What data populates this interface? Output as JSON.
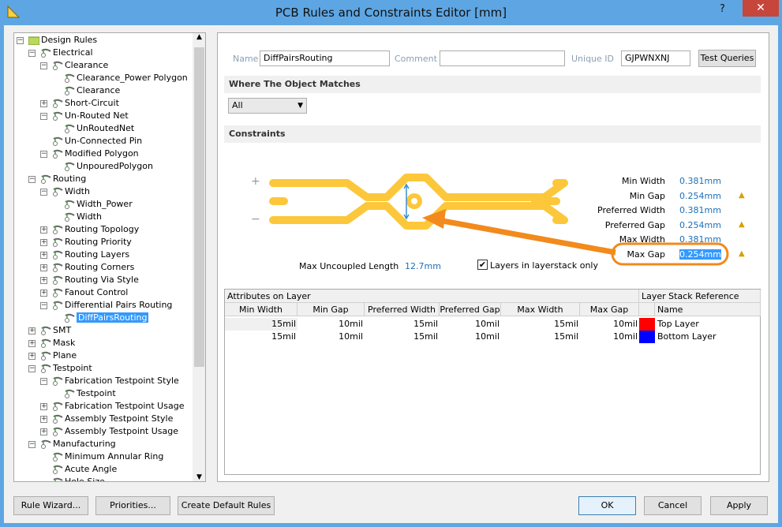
{
  "window": {
    "title": "PCB Rules and Constraints Editor [mm]",
    "help": "?",
    "close": "✕"
  },
  "tree": [
    {
      "label": "Design Rules",
      "level": 0,
      "exp": "-"
    },
    {
      "label": "Electrical",
      "level": 1,
      "exp": "-"
    },
    {
      "label": "Clearance",
      "level": 2,
      "exp": "-"
    },
    {
      "label": "Clearance_Power Polygon",
      "level": 3
    },
    {
      "label": "Clearance",
      "level": 3
    },
    {
      "label": "Short-Circuit",
      "level": 2,
      "exp": "+"
    },
    {
      "label": "Un-Routed Net",
      "level": 2,
      "exp": "-"
    },
    {
      "label": "UnRoutedNet",
      "level": 3
    },
    {
      "label": "Un-Connected Pin",
      "level": 2
    },
    {
      "label": "Modified Polygon",
      "level": 2,
      "exp": "-"
    },
    {
      "label": "UnpouredPolygon",
      "level": 3
    },
    {
      "label": "Routing",
      "level": 1,
      "exp": "-"
    },
    {
      "label": "Width",
      "level": 2,
      "exp": "-"
    },
    {
      "label": "Width_Power",
      "level": 3
    },
    {
      "label": "Width",
      "level": 3
    },
    {
      "label": "Routing Topology",
      "level": 2,
      "exp": "+"
    },
    {
      "label": "Routing Priority",
      "level": 2,
      "exp": "+"
    },
    {
      "label": "Routing Layers",
      "level": 2,
      "exp": "+"
    },
    {
      "label": "Routing Corners",
      "level": 2,
      "exp": "+"
    },
    {
      "label": "Routing Via Style",
      "level": 2,
      "exp": "+"
    },
    {
      "label": "Fanout Control",
      "level": 2,
      "exp": "+"
    },
    {
      "label": "Differential Pairs Routing",
      "level": 2,
      "exp": "-"
    },
    {
      "label": "DiffPairsRouting",
      "level": 3,
      "selected": true
    },
    {
      "label": "SMT",
      "level": 1,
      "exp": "+"
    },
    {
      "label": "Mask",
      "level": 1,
      "exp": "+"
    },
    {
      "label": "Plane",
      "level": 1,
      "exp": "+"
    },
    {
      "label": "Testpoint",
      "level": 1,
      "exp": "-"
    },
    {
      "label": "Fabrication Testpoint Style",
      "level": 2,
      "exp": "-"
    },
    {
      "label": "Testpoint",
      "level": 3
    },
    {
      "label": "Fabrication Testpoint Usage",
      "level": 2,
      "exp": "+"
    },
    {
      "label": "Assembly Testpoint Style",
      "level": 2,
      "exp": "+"
    },
    {
      "label": "Assembly Testpoint Usage",
      "level": 2,
      "exp": "+"
    },
    {
      "label": "Manufacturing",
      "level": 1,
      "exp": "-"
    },
    {
      "label": "Minimum Annular Ring",
      "level": 2
    },
    {
      "label": "Acute Angle",
      "level": 2
    },
    {
      "label": "Hole Size",
      "level": 2
    }
  ],
  "rule": {
    "name_label": "Name",
    "name": "DiffPairsRouting",
    "comment_label": "Comment",
    "comment": "",
    "uid_label": "Unique ID",
    "uid": "GJPWNXNJ",
    "test_queries": "Test Queries"
  },
  "where": {
    "title": "Where The Object Matches",
    "scope": "All"
  },
  "constraints": {
    "title": "Constraints",
    "plus": "+",
    "minus": "−",
    "items": [
      {
        "label": "Min Width",
        "value": "0.381mm",
        "warn": false
      },
      {
        "label": "Min Gap",
        "value": "0.254mm",
        "warn": true
      },
      {
        "label": "Preferred Width",
        "value": "0.381mm",
        "warn": false
      },
      {
        "label": "Preferred Gap",
        "value": "0.254mm",
        "warn": true
      },
      {
        "label": "Max Width",
        "value": "0.381mm",
        "warn": false
      },
      {
        "label": "Max Gap",
        "value": "0.254mm",
        "warn": true
      }
    ],
    "max_uncoupled_label": "Max Uncoupled Length",
    "max_uncoupled": "12.7mm",
    "layers_only_label": "Layers in layerstack only",
    "layers_only": true
  },
  "table": {
    "group1": "Attributes on Layer",
    "group2": "Layer Stack Reference",
    "headers": [
      "Min Width",
      "Min Gap",
      "Preferred Width",
      "Preferred Gap",
      "Max Width",
      "Max Gap",
      "Name"
    ],
    "rows": [
      {
        "cells": [
          "15mil",
          "10mil",
          "15mil",
          "10mil",
          "15mil",
          "10mil"
        ],
        "color": "#ff0000",
        "layer": "Top Layer"
      },
      {
        "cells": [
          "15mil",
          "10mil",
          "15mil",
          "10mil",
          "15mil",
          "10mil"
        ],
        "color": "#0000ff",
        "layer": "Bottom Layer"
      }
    ]
  },
  "footer": {
    "wizard": "Rule Wizard...",
    "priorities": "Priorities...",
    "defaults": "Create Default Rules",
    "ok": "OK",
    "cancel": "Cancel",
    "apply": "Apply"
  },
  "colors": {
    "trace": "#fcc73a",
    "annotation": "#f28a1c",
    "value": "#1e6fb8"
  }
}
